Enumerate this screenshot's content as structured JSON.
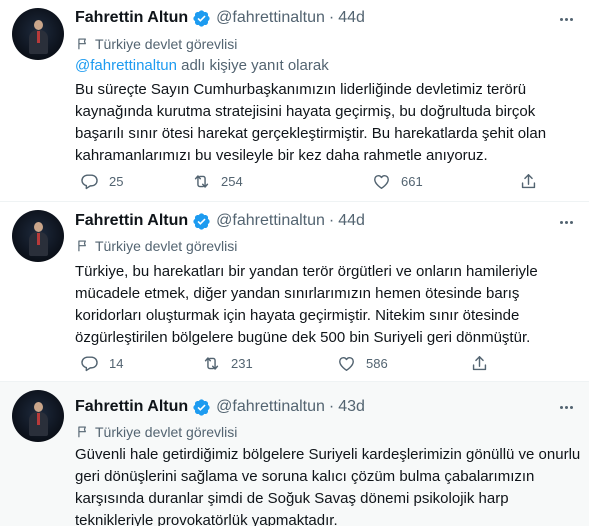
{
  "tweets": [
    {
      "author_name": "Fahrettin Altun",
      "handle": "@fahrettinaltun",
      "separator": "·",
      "time": "44d",
      "label": "Türkiye devlet görevlisi",
      "reply_to_mention": "@fahrettinaltun",
      "reply_to_suffix": " adlı kişiye yanıt olarak",
      "text_lines": [
        "Bu süreçte Sayın Cumhurbaşkanımızın liderliğinde devletimiz terörü",
        "kaynağında kurutma stratejisini hayata geçirmiş, bu doğrultuda birçok",
        "başarılı sınır ötesi harekat gerçekleştirmiştir. Bu harekatlarda şehit olan",
        "kahramanlarımızı bu vesileyle bir kez daha rahmetle anıyoruz."
      ],
      "replies": "25",
      "retweets": "254",
      "likes": "661"
    },
    {
      "author_name": "Fahrettin Altun",
      "handle": "@fahrettinaltun",
      "separator": "·",
      "time": "44d",
      "label": "Türkiye devlet görevlisi",
      "text_lines": [
        "Türkiye, bu harekatları bir yandan terör örgütleri ve onların hamileriyle",
        "mücadele etmek, diğer yandan sınırlarımızın hemen ötesinde barış",
        "koridorları oluşturmak için hayata geçirmiştir. Nitekim sınır ötesinde",
        "özgürleştirilen bölgelere bugüne dek 500 bin Suriyeli geri dönmüştür."
      ],
      "replies": "14",
      "retweets": "231",
      "likes": "586"
    },
    {
      "author_name": "Fahrettin Altun",
      "handle": "@fahrettinaltun",
      "separator": "·",
      "time": "43d",
      "label": "Türkiye devlet görevlisi",
      "text_lines": [
        "Güvenli hale getirdiğimiz bölgelere Suriyeli kardeşlerimizin gönüllü ve onurlu",
        "geri dönüşlerini sağlama ve soruna kalıcı çözüm bulma çabalarımızın",
        "karşısında duranlar şimdi de Soğuk Savaş dönemi psikolojik harp",
        "teknikleriyle provokatörlük yapmaktadır."
      ]
    }
  ],
  "colors": {
    "accent": "#1d9bf0",
    "secondary_text": "#536471",
    "primary_text": "#0f1419",
    "highlight_bg": "#f7f9f9"
  },
  "icons": {
    "verified": "verified-badge-icon",
    "label": "flag-icon",
    "more": "more-icon",
    "reply": "reply-icon",
    "retweet": "retweet-icon",
    "like": "heart-icon",
    "share": "share-icon"
  }
}
